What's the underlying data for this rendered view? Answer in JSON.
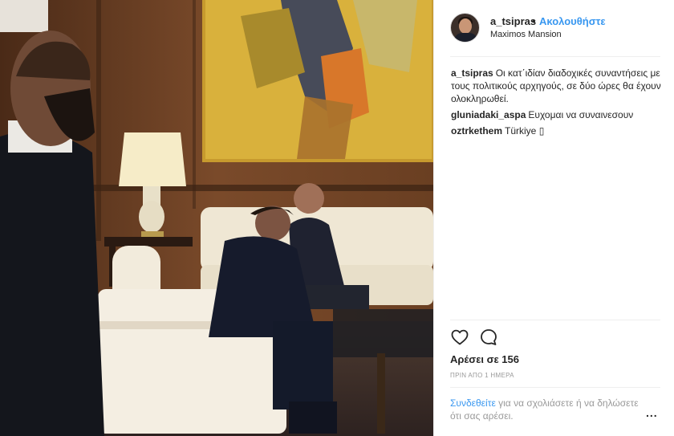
{
  "post": {
    "username": "a_tsipras",
    "dot": "•",
    "follow_label": "Ακολουθήστε",
    "location": "Maximos Mansion",
    "likes_text": "Αρέσει σε 156",
    "time_text": "ΠΡΙΝ ΑΠΟ 1 ΗΜΕΡΑ",
    "login_link": "Συνδεθείτε",
    "login_rest": " για να σχολιάσετε ή να δηλώσετε ότι σας αρέσει.",
    "more_label": "..."
  },
  "comments": [
    {
      "user": "a_tsipras",
      "text": "Οι κατ΄ιδίαν διαδοχικές συναντήσεις με τους πολιτικούς αρχηγούς, σε δύο ώρες θα έχουν ολοκληρωθεί."
    },
    {
      "user": "gluniadaki_aspa",
      "text": "Ευχομαι να συναινεσουν"
    },
    {
      "user": "oztrkethem",
      "text": "Türkiye ▯"
    }
  ],
  "icons": {
    "like": "heart-icon",
    "comment": "comment-icon"
  },
  "colors": {
    "link": "#3897f0",
    "text": "#262626",
    "muted": "#999999"
  }
}
